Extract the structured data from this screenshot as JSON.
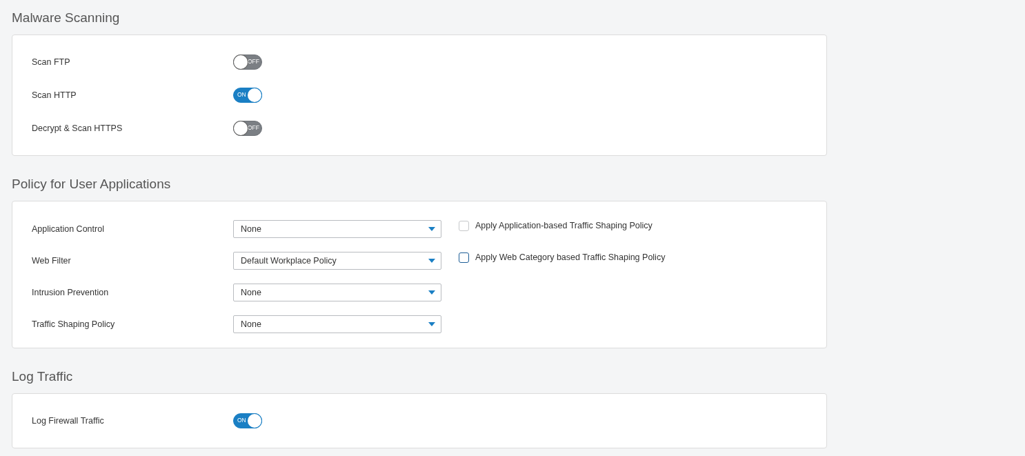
{
  "sections": [
    {
      "title": "Malware Scanning",
      "rows": [
        {
          "kind": "toggle",
          "label": "Scan FTP",
          "on": false,
          "toggle_text": "OFF"
        },
        {
          "kind": "toggle",
          "label": "Scan HTTP",
          "on": true,
          "toggle_text": "ON"
        },
        {
          "kind": "toggle",
          "label": "Decrypt & Scan HTTPS",
          "on": false,
          "toggle_text": "OFF"
        }
      ]
    },
    {
      "title": "Policy for User Applications",
      "rows": [
        {
          "kind": "select",
          "label": "Application Control",
          "value": "None",
          "checkbox": {
            "label": "Apply Application-based Traffic Shaping Policy",
            "checked": false,
            "disabled": true
          }
        },
        {
          "kind": "select",
          "label": "Web Filter",
          "value": "Default Workplace Policy",
          "checkbox": {
            "label": "Apply Web Category based Traffic Shaping Policy",
            "checked": false,
            "disabled": false
          }
        },
        {
          "kind": "select",
          "label": "Intrusion Prevention",
          "value": "None"
        },
        {
          "kind": "select",
          "label": "Traffic Shaping Policy",
          "value": "None"
        }
      ]
    },
    {
      "title": "Log Traffic",
      "rows": [
        {
          "kind": "toggle",
          "label": "Log Firewall Traffic",
          "on": true,
          "toggle_text": "ON"
        }
      ]
    }
  ]
}
